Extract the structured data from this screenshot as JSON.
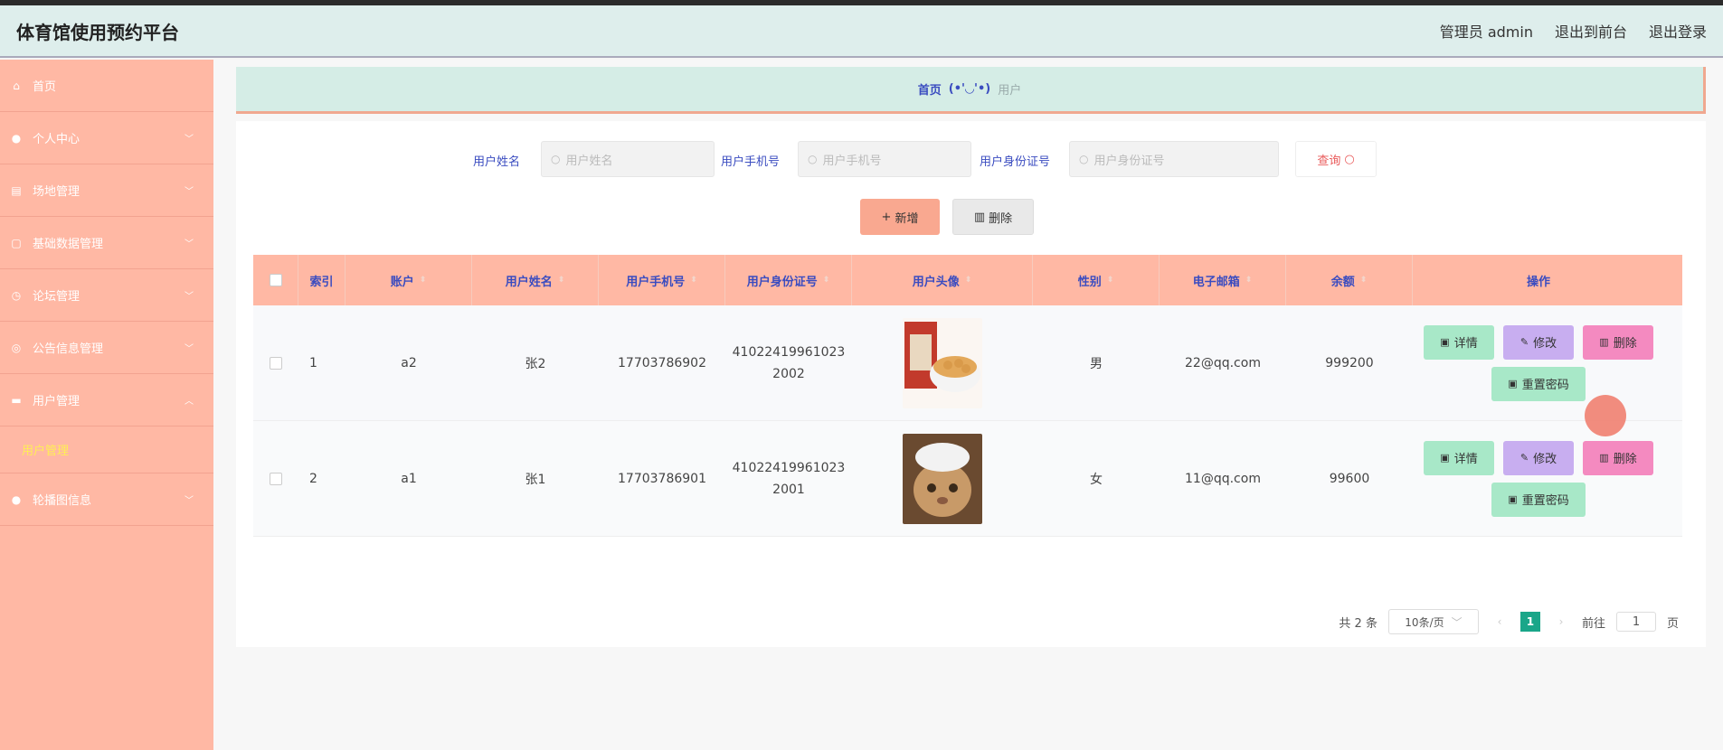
{
  "header": {
    "title": "体育馆使用预约平台",
    "admin": "管理员 admin",
    "to_front": "退出到前台",
    "logout": "退出登录"
  },
  "sidebar": {
    "items": [
      {
        "label": "首页",
        "icon": "home-icon"
      },
      {
        "label": "个人中心",
        "icon": "user-icon"
      },
      {
        "label": "场地管理",
        "icon": "clipboard-icon"
      },
      {
        "label": "基础数据管理",
        "icon": "database-icon"
      },
      {
        "label": "论坛管理",
        "icon": "clock-icon"
      },
      {
        "label": "公告信息管理",
        "icon": "compass-icon"
      },
      {
        "label": "用户管理",
        "icon": "briefcase-icon"
      },
      {
        "label": "轮播图信息",
        "icon": "pin-icon"
      }
    ],
    "sub_active": "用户管理"
  },
  "breadcrumb": {
    "home": "首页",
    "face": "(•'◡'•)",
    "current": "用户"
  },
  "search": {
    "name_label": "用户姓名",
    "name_placeholder": "用户姓名",
    "phone_label": "用户手机号",
    "phone_placeholder": "用户手机号",
    "id_label": "用户身份证号",
    "id_placeholder": "用户身份证号",
    "query": "查询"
  },
  "actions": {
    "add": "新增",
    "delete": "删除"
  },
  "table": {
    "headers": [
      "索引",
      "账户",
      "用户姓名",
      "用户手机号",
      "用户身份证号",
      "用户头像",
      "性别",
      "电子邮箱",
      "余额",
      "操作"
    ],
    "rows": [
      {
        "index": "1",
        "account": "a2",
        "name": "张2",
        "phone": "17703786902",
        "id1": "41022419961023",
        "id2": "2002",
        "gender": "男",
        "email": "22@qq.com",
        "balance": "999200"
      },
      {
        "index": "2",
        "account": "a1",
        "name": "张1",
        "phone": "17703786901",
        "id1": "41022419961023",
        "id2": "2001",
        "gender": "女",
        "email": "11@qq.com",
        "balance": "99600"
      }
    ],
    "ops": {
      "detail": "详情",
      "edit": "修改",
      "delete": "删除",
      "reset": "重置密码"
    }
  },
  "pager": {
    "total": "共 2 条",
    "size": "10条/页",
    "current": "1",
    "goto": "前往",
    "goto_value": "1",
    "page_unit": "页"
  }
}
